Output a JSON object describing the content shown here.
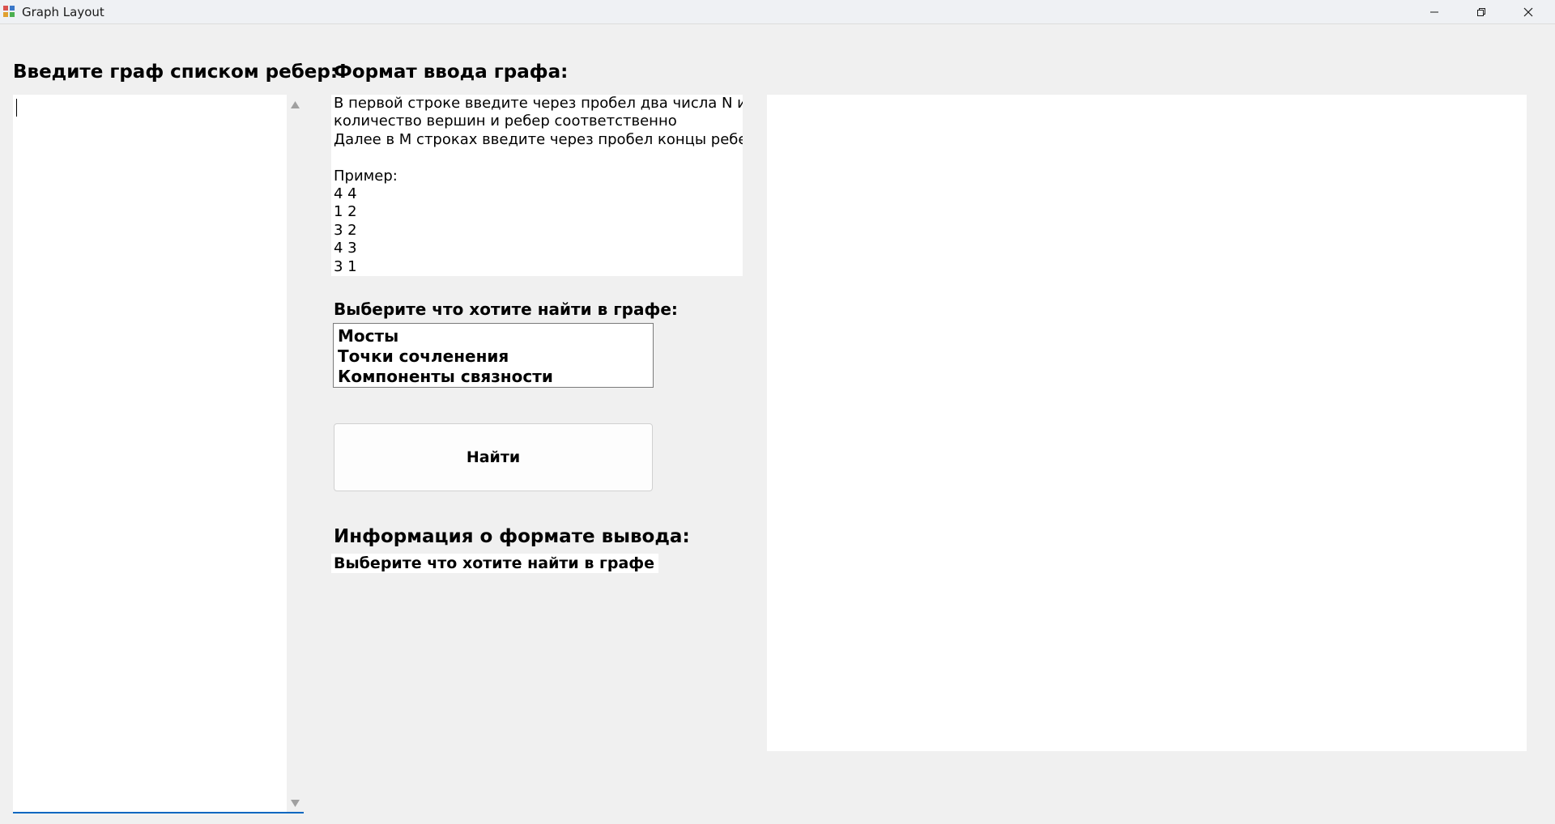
{
  "window": {
    "title": "Graph Layout",
    "icons": {
      "app": "app-icon",
      "minimize": "minimize-icon",
      "maximize": "restore-icon",
      "close": "close-icon"
    }
  },
  "edges_panel": {
    "heading": "Введите граф списком ребер:",
    "value": ""
  },
  "format_panel": {
    "heading": "Формат ввода графа:",
    "lines": [
      "В первой строке введите через пробел два числа N и M:",
      "количество вершин и ребер соответственно",
      "Далее в M строках введите через пробел концы ребер.",
      "",
      "Пример:",
      "4 4",
      "1 2",
      "3 2",
      "4 3",
      "3 1"
    ]
  },
  "search": {
    "heading": "Выберите что хотите найти в графе:",
    "options": [
      "Мосты",
      "Точки сочленения",
      "Компоненты связности"
    ],
    "find_label": "Найти"
  },
  "output": {
    "heading": "Информация о формате вывода:",
    "text": "Выберите что хотите найти в графе"
  }
}
